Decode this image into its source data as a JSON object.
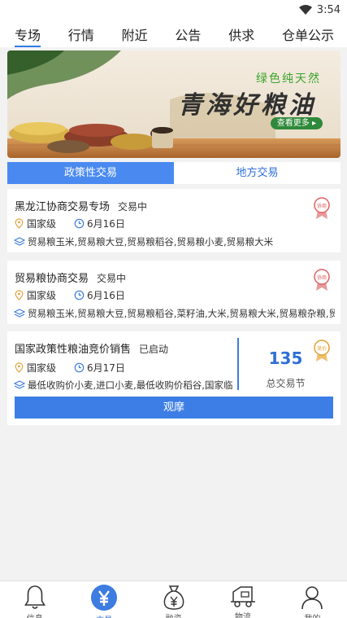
{
  "status": {
    "time": "3:54"
  },
  "tabs": [
    "专场",
    "行情",
    "附近",
    "公告",
    "供求",
    "仓单公示"
  ],
  "banner": {
    "slogan": "绿色纯天然",
    "headline": "青海好粮油",
    "more_label": "查看更多"
  },
  "segment": {
    "left": "政策性交易",
    "right": "地方交易"
  },
  "cards": [
    {
      "title": "黑龙江协商交易专场",
      "state": "交易中",
      "level": "国家级",
      "date": "6月16日",
      "items": "贸易粮玉米,贸易粮大豆,贸易粮稻谷,贸易粮小麦,贸易粮大米",
      "badge": "协商"
    },
    {
      "title": "贸易粮协商交易",
      "state": "交易中",
      "level": "国家级",
      "date": "6月16日",
      "items": "贸易粮玉米,贸易粮大豆,贸易粮稻谷,菜籽油,大米,贸易粮大米,贸易粮杂粮,贸",
      "badge": "协商"
    },
    {
      "title": "国家政策性粮油竞价销售",
      "state": "已启动",
      "level": "国家级",
      "date": "6月17日",
      "items": "最低收购价小麦,进口小麦,最低收购价稻谷,国家临",
      "badge": "竞价",
      "stat_value": "135",
      "stat_label": "总交易节",
      "button": "观摩"
    }
  ],
  "colors": {
    "accent": "#2f7be6",
    "badge": "#e06060",
    "badge_gold": "#e0a030"
  },
  "nav": [
    {
      "label": "信息",
      "icon": "bell-icon"
    },
    {
      "label": "交易",
      "icon": "yuan-icon",
      "active": true
    },
    {
      "label": "融资",
      "icon": "money-bag-icon"
    },
    {
      "label": "物流",
      "icon": "truck-icon"
    },
    {
      "label": "我的",
      "icon": "user-icon"
    }
  ]
}
